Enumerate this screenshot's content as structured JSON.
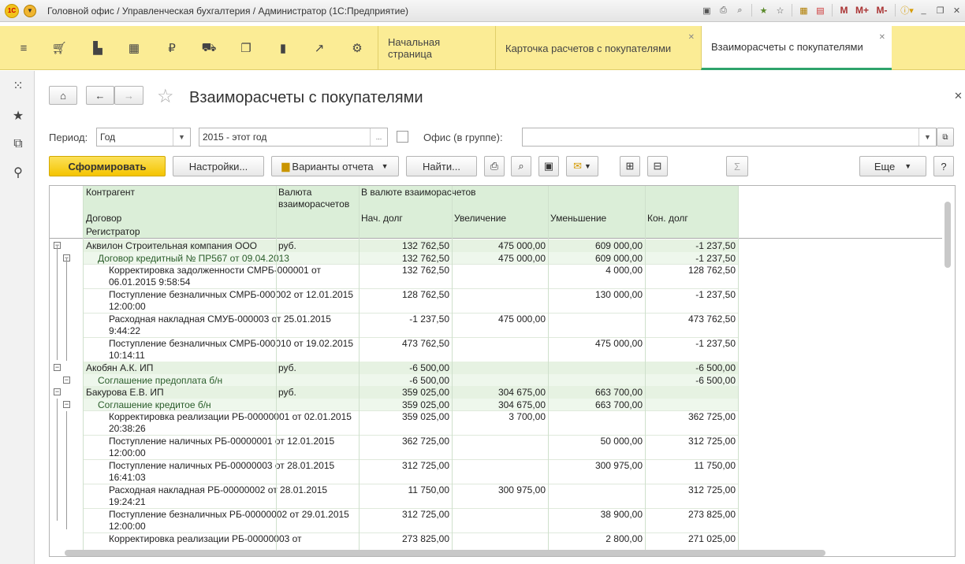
{
  "window": {
    "title": "Головной офис / Управленческая бухгалтерия / Администратор  (1С:Предприятие)",
    "logo": "1С"
  },
  "titlebar_icons": [
    "save-icon",
    "print-icon",
    "preview-icon",
    "favorites-star-icon",
    "bookmark-star-icon",
    "calculator-icon",
    "calendar-icon",
    "M",
    "M+",
    "M-",
    "info-icon",
    "minimize-icon",
    "restore-icon",
    "close-icon"
  ],
  "tabs": [
    {
      "label": "Начальная страница",
      "closable": false
    },
    {
      "label": "Карточка расчетов с покупателями",
      "closable": true
    },
    {
      "label": "Взаиморасчеты с покупателями",
      "closable": true,
      "active": true
    }
  ],
  "page": {
    "title": "Взаиморасчеты с покупателями"
  },
  "filters": {
    "period_label": "Период:",
    "period_type": "Год",
    "period_value": "2015 - этот год",
    "period_more": "...",
    "office_label": "Офис (в группе):",
    "office_value": ""
  },
  "toolbar": {
    "generate": "Сформировать",
    "settings": "Настройки...",
    "variants": "Варианты отчета",
    "find": "Найти...",
    "more": "Еще",
    "help": "?",
    "sum": "Σ"
  },
  "report": {
    "headers": {
      "counterparty": "Контрагент",
      "currency": "Валюта взаиморасчетов",
      "in_currency": "В валюте взаиморасчетов",
      "contract": "Договор",
      "registrar": "Регистратор",
      "start_debt": "Нач. долг",
      "increase": "Увеличение",
      "decrease": "Уменьшение",
      "end_debt": "Кон. долг"
    },
    "rows": [
      {
        "level": 0,
        "name": "Аквилон Строительная компания ООО",
        "cur": "руб.",
        "start": "132 762,50",
        "inc": "475 000,00",
        "dec": "609 000,00",
        "end": "-1 237,50"
      },
      {
        "level": 1,
        "name": "Договор кредитный № ПР567 от 09.04.2013",
        "cur": "",
        "start": "132 762,50",
        "inc": "475 000,00",
        "dec": "609 000,00",
        "end": "-1 237,50"
      },
      {
        "level": 2,
        "name": "Корректировка задолженности СМРБ-000001 от 06.01.2015 9:58:54",
        "cur": "",
        "start": "132 762,50",
        "inc": "",
        "dec": "4 000,00",
        "end": "128 762,50"
      },
      {
        "level": 2,
        "name": "Поступление безналичных СМРБ-000002 от 12.01.2015 12:00:00",
        "cur": "",
        "start": "128 762,50",
        "inc": "",
        "dec": "130 000,00",
        "end": "-1 237,50"
      },
      {
        "level": 2,
        "name": "Расходная накладная СМУБ-000003 от 25.01.2015 9:44:22",
        "cur": "",
        "start": "-1 237,50",
        "inc": "475 000,00",
        "dec": "",
        "end": "473 762,50"
      },
      {
        "level": 2,
        "name": "Поступление безналичных СМРБ-000010 от 19.02.2015 10:14:11",
        "cur": "",
        "start": "473 762,50",
        "inc": "",
        "dec": "475 000,00",
        "end": "-1 237,50"
      },
      {
        "level": 0,
        "name": "Акобян А.К. ИП",
        "cur": "руб.",
        "start": "-6 500,00",
        "inc": "",
        "dec": "",
        "end": "-6 500,00"
      },
      {
        "level": 1,
        "name": "Соглашение предоплата б/н",
        "cur": "",
        "start": "-6 500,00",
        "inc": "",
        "dec": "",
        "end": "-6 500,00"
      },
      {
        "level": 0,
        "name": "Бакурова Е.В. ИП",
        "cur": "руб.",
        "start": "359 025,00",
        "inc": "304 675,00",
        "dec": "663 700,00",
        "end": ""
      },
      {
        "level": 1,
        "name": "Соглашение кредитое б/н",
        "cur": "",
        "start": "359 025,00",
        "inc": "304 675,00",
        "dec": "663 700,00",
        "end": ""
      },
      {
        "level": 2,
        "name": "Корректировка реализации РБ-00000001 от 02.01.2015 20:38:26",
        "cur": "",
        "start": "359 025,00",
        "inc": "3 700,00",
        "dec": "",
        "end": "362 725,00"
      },
      {
        "level": 2,
        "name": "Поступление наличных РБ-00000001 от 12.01.2015 12:00:00",
        "cur": "",
        "start": "362 725,00",
        "inc": "",
        "dec": "50 000,00",
        "end": "312 725,00"
      },
      {
        "level": 2,
        "name": "Поступление наличных РБ-00000003 от 28.01.2015 16:41:03",
        "cur": "",
        "start": "312 725,00",
        "inc": "",
        "dec": "300 975,00",
        "end": "11 750,00"
      },
      {
        "level": 2,
        "name": "Расходная накладная РБ-00000002 от 28.01.2015 19:24:21",
        "cur": "",
        "start": "11 750,00",
        "inc": "300 975,00",
        "dec": "",
        "end": "312 725,00"
      },
      {
        "level": 2,
        "name": "Поступление безналичных РБ-00000002 от 29.01.2015 12:00:00",
        "cur": "",
        "start": "312 725,00",
        "inc": "",
        "dec": "38 900,00",
        "end": "273 825,00"
      },
      {
        "level": 2,
        "name": "Корректировка реализации РБ-00000003 от",
        "cur": "",
        "start": "273 825,00",
        "inc": "",
        "dec": "2 800,00",
        "end": "271 025,00"
      }
    ]
  }
}
